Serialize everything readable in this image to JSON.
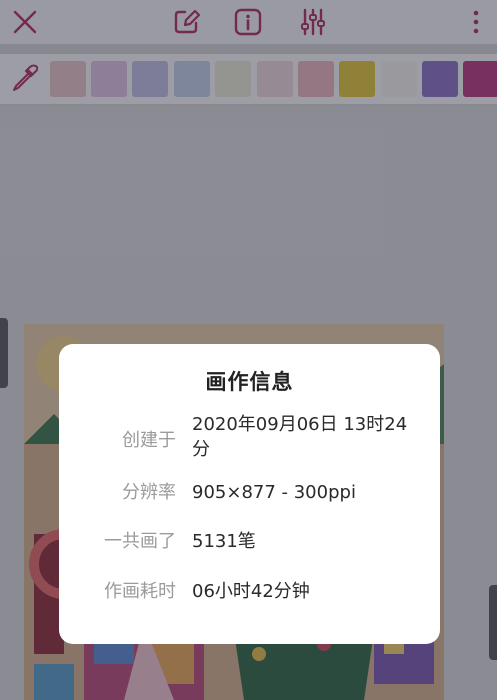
{
  "toolbar": {
    "icons": [
      "close-icon",
      "edit-canvas-icon",
      "info-icon",
      "adjust-sliders-icon",
      "more-vertical-icon"
    ],
    "accent_color": "#b0315f"
  },
  "palette": {
    "icons": [
      "eyedropper-icon"
    ],
    "swatches": [
      "#e8c7c7",
      "#e3c5e3",
      "#c3c2e8",
      "#c3d3ea",
      "#ececd8",
      "#efd9de",
      "#ebb8bd",
      "#e2c93a",
      "#f4f4ef",
      "#8d72c8",
      "#b63b82"
    ]
  },
  "dialog": {
    "title": "画作信息",
    "rows": [
      {
        "label": "创建于",
        "value": "2020年09月06日 13时24分"
      },
      {
        "label": "分辨率",
        "value": "905×877 - 300ppi"
      },
      {
        "label": "一共画了",
        "value": "5131笔"
      },
      {
        "label": "作画耗时",
        "value": "06小时42分钟"
      }
    ]
  }
}
